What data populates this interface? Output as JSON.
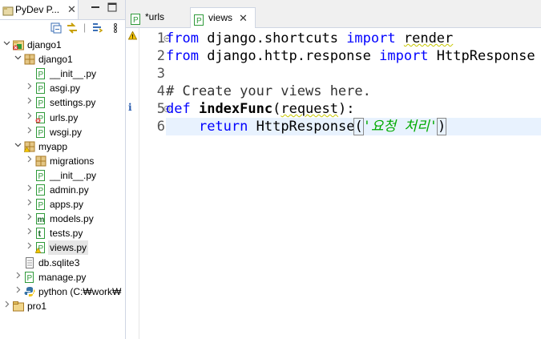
{
  "explorer": {
    "tab_label": "PyDev P...",
    "tab_close": "✕",
    "minimize": "▭",
    "maximize": "▢",
    "tree": [
      {
        "label": "django1",
        "indent": 0,
        "arrow": "v",
        "icon": "django-project-icon"
      },
      {
        "label": "django1",
        "indent": 1,
        "arrow": "v",
        "icon": "package-icon"
      },
      {
        "label": "__init__.py",
        "indent": 2,
        "arrow": "",
        "icon": "python-file-icon"
      },
      {
        "label": "asgi.py",
        "indent": 2,
        "arrow": ">",
        "icon": "python-file-icon"
      },
      {
        "label": "settings.py",
        "indent": 2,
        "arrow": ">",
        "icon": "python-file-icon"
      },
      {
        "label": "urls.py",
        "indent": 2,
        "arrow": ">",
        "icon": "python-file-error-icon"
      },
      {
        "label": "wsgi.py",
        "indent": 2,
        "arrow": ">",
        "icon": "python-file-icon"
      },
      {
        "label": "myapp",
        "indent": 1,
        "arrow": "v",
        "icon": "package-warning-icon"
      },
      {
        "label": "migrations",
        "indent": 2,
        "arrow": ">",
        "icon": "package-icon"
      },
      {
        "label": "__init__.py",
        "indent": 2,
        "arrow": "",
        "icon": "python-file-icon"
      },
      {
        "label": "admin.py",
        "indent": 2,
        "arrow": ">",
        "icon": "python-file-icon"
      },
      {
        "label": "apps.py",
        "indent": 2,
        "arrow": ">",
        "icon": "python-file-icon"
      },
      {
        "label": "models.py",
        "indent": 2,
        "arrow": ">",
        "icon": "models-file-icon"
      },
      {
        "label": "tests.py",
        "indent": 2,
        "arrow": ">",
        "icon": "tests-file-icon"
      },
      {
        "label": "views.py",
        "indent": 2,
        "arrow": ">",
        "icon": "python-file-warning-icon",
        "selected": true
      },
      {
        "label": "db.sqlite3",
        "indent": 1,
        "arrow": "",
        "icon": "database-file-icon"
      },
      {
        "label": "manage.py",
        "indent": 1,
        "arrow": ">",
        "icon": "python-file-icon"
      },
      {
        "label": "python   (C:₩work₩",
        "indent": 1,
        "arrow": ">",
        "icon": "python-interpreter-icon"
      },
      {
        "label": "pro1",
        "indent": 0,
        "arrow": ">",
        "icon": "folder-icon"
      }
    ]
  },
  "editor": {
    "tabs": [
      {
        "label": "*urls",
        "active": false
      },
      {
        "label": "views",
        "active": true,
        "close": "✕"
      }
    ],
    "line_numbers": [
      "1",
      "2",
      "3",
      "4",
      "5",
      "6"
    ],
    "lines": [
      [
        {
          "t": "from",
          "c": "kw"
        },
        {
          "t": " django.shortcuts ",
          "c": ""
        },
        {
          "t": "import",
          "c": "kw"
        },
        {
          "t": " ",
          "c": ""
        },
        {
          "t": "render",
          "c": "squig"
        }
      ],
      [
        {
          "t": "from",
          "c": "kw"
        },
        {
          "t": " django.http.response ",
          "c": ""
        },
        {
          "t": "import",
          "c": "kw"
        },
        {
          "t": " HttpResponse",
          "c": ""
        }
      ],
      [],
      [
        {
          "t": "# Create your views here.",
          "c": "cm"
        }
      ],
      [
        {
          "t": "def",
          "c": "kw"
        },
        {
          "t": " ",
          "c": ""
        },
        {
          "t": "indexFunc",
          "c": "fn"
        },
        {
          "t": "(",
          "c": ""
        },
        {
          "t": "request",
          "c": "squig"
        },
        {
          "t": "):",
          "c": ""
        }
      ],
      [
        {
          "t": "    ",
          "c": ""
        },
        {
          "t": "return",
          "c": "kw"
        },
        {
          "t": " HttpResponse",
          "c": ""
        },
        {
          "t": "(",
          "c": "brk"
        },
        {
          "t": "'요청 처리'",
          "c": "str"
        },
        {
          "t": ")",
          "c": "brk"
        }
      ]
    ],
    "markers": {
      "line1": "warning",
      "line5": "info"
    }
  }
}
